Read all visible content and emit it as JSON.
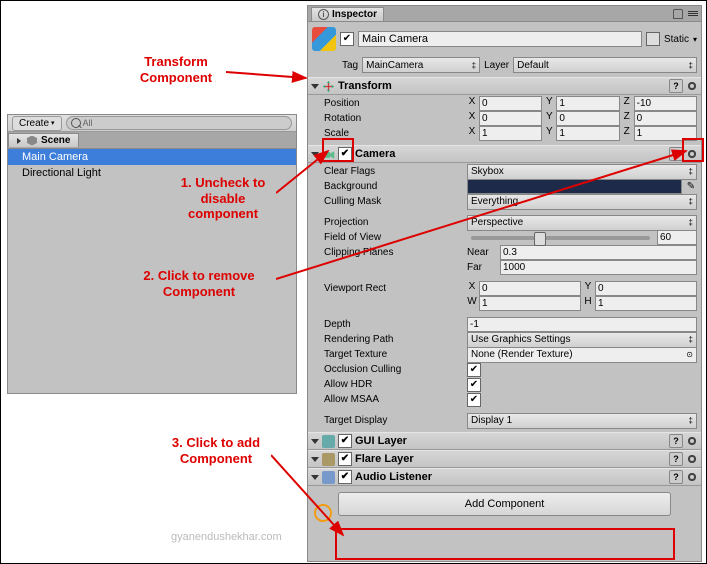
{
  "hierarchy": {
    "create_label": "Create",
    "search_placeholder": "All",
    "tab": "Scene",
    "items": [
      "Main Camera",
      "Directional Light"
    ]
  },
  "inspector": {
    "tab": "Inspector",
    "object_name": "Main Camera",
    "static_label": "Static",
    "tag_label": "Tag",
    "tag_value": "MainCamera",
    "layer_label": "Layer",
    "layer_value": "Default"
  },
  "transform": {
    "title": "Transform",
    "position_label": "Position",
    "rotation_label": "Rotation",
    "scale_label": "Scale",
    "position": {
      "x": "0",
      "y": "1",
      "z": "-10"
    },
    "rotation": {
      "x": "0",
      "y": "0",
      "z": "0"
    },
    "scale": {
      "x": "1",
      "y": "1",
      "z": "1"
    }
  },
  "camera": {
    "title": "Camera",
    "clear_flags_label": "Clear Flags",
    "clear_flags_value": "Skybox",
    "background_label": "Background",
    "culling_label": "Culling Mask",
    "culling_value": "Everything",
    "projection_label": "Projection",
    "projection_value": "Perspective",
    "fov_label": "Field of View",
    "fov_value": "60",
    "clip_label": "Clipping Planes",
    "near_label": "Near",
    "near_value": "0.3",
    "far_label": "Far",
    "far_value": "1000",
    "viewport_label": "Viewport Rect",
    "viewport": {
      "x": "0",
      "y": "0",
      "w": "1",
      "h": "1"
    },
    "depth_label": "Depth",
    "depth_value": "-1",
    "render_path_label": "Rendering Path",
    "render_path_value": "Use Graphics Settings",
    "target_tex_label": "Target Texture",
    "target_tex_value": "None (Render Texture)",
    "occlusion_label": "Occlusion Culling",
    "hdr_label": "Allow HDR",
    "msaa_label": "Allow MSAA",
    "target_display_label": "Target Display",
    "target_display_value": "Display 1"
  },
  "gui_layer": {
    "title": "GUI Layer"
  },
  "flare_layer": {
    "title": "Flare Layer"
  },
  "audio_listener": {
    "title": "Audio Listener"
  },
  "add_component": "Add Component",
  "annotations": {
    "transform": "Transform\nComponent",
    "uncheck": "1. Uncheck to\ndisable\ncomponent",
    "remove": "2. Click to remove\nComponent",
    "add": "3. Click to add\nComponent"
  },
  "watermark": "gyanendushekhar.com"
}
